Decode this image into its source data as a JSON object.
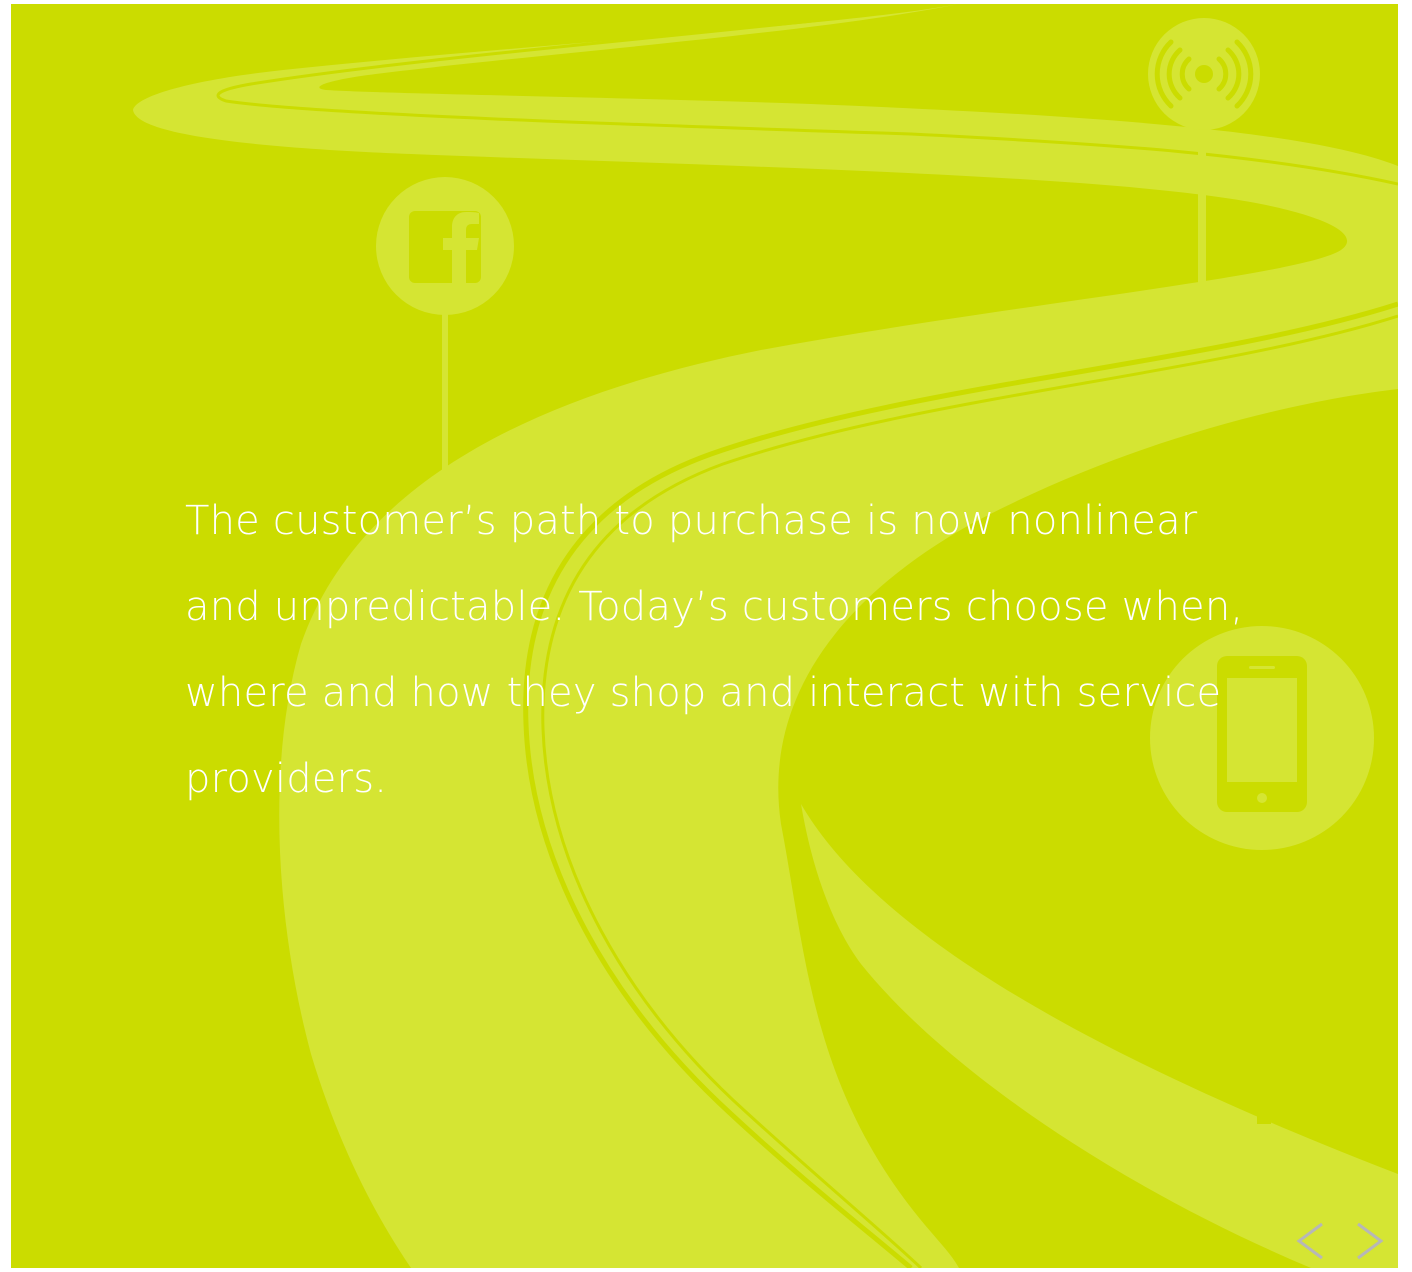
{
  "slide": {
    "background_color": "#cbdc00",
    "road_color": "#d5e533",
    "accent_color": "#ffffff",
    "caption": "The customer’s path to purchase is now nonlinear and unpredictable. Today’s customers choose when, where and how they shop and interact with service providers.",
    "signs": [
      "facebook-icon",
      "wireless-broadcast-icon",
      "smartphone-icon"
    ]
  },
  "navigation": {
    "prev_icon": "chevron-left-icon",
    "next_icon": "chevron-right-icon",
    "color": "#b7b7b7"
  }
}
